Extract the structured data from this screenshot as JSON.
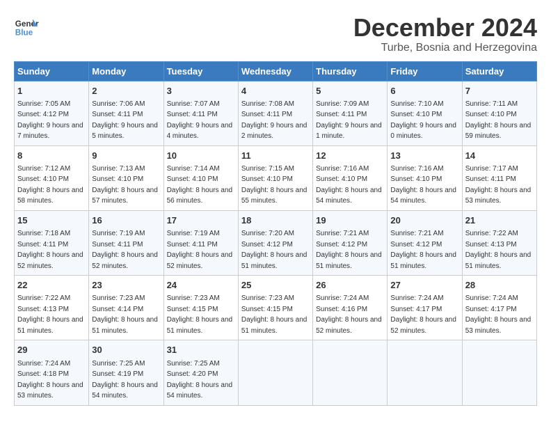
{
  "header": {
    "logo_general": "General",
    "logo_blue": "Blue",
    "title": "December 2024",
    "subtitle": "Turbe, Bosnia and Herzegovina"
  },
  "weekdays": [
    "Sunday",
    "Monday",
    "Tuesday",
    "Wednesday",
    "Thursday",
    "Friday",
    "Saturday"
  ],
  "weeks": [
    [
      {
        "day": "1",
        "sunrise": "7:05 AM",
        "sunset": "4:12 PM",
        "daylight": "9 hours and 7 minutes."
      },
      {
        "day": "2",
        "sunrise": "7:06 AM",
        "sunset": "4:11 PM",
        "daylight": "9 hours and 5 minutes."
      },
      {
        "day": "3",
        "sunrise": "7:07 AM",
        "sunset": "4:11 PM",
        "daylight": "9 hours and 4 minutes."
      },
      {
        "day": "4",
        "sunrise": "7:08 AM",
        "sunset": "4:11 PM",
        "daylight": "9 hours and 2 minutes."
      },
      {
        "day": "5",
        "sunrise": "7:09 AM",
        "sunset": "4:11 PM",
        "daylight": "9 hours and 1 minute."
      },
      {
        "day": "6",
        "sunrise": "7:10 AM",
        "sunset": "4:10 PM",
        "daylight": "9 hours and 0 minutes."
      },
      {
        "day": "7",
        "sunrise": "7:11 AM",
        "sunset": "4:10 PM",
        "daylight": "8 hours and 59 minutes."
      }
    ],
    [
      {
        "day": "8",
        "sunrise": "7:12 AM",
        "sunset": "4:10 PM",
        "daylight": "8 hours and 58 minutes."
      },
      {
        "day": "9",
        "sunrise": "7:13 AM",
        "sunset": "4:10 PM",
        "daylight": "8 hours and 57 minutes."
      },
      {
        "day": "10",
        "sunrise": "7:14 AM",
        "sunset": "4:10 PM",
        "daylight": "8 hours and 56 minutes."
      },
      {
        "day": "11",
        "sunrise": "7:15 AM",
        "sunset": "4:10 PM",
        "daylight": "8 hours and 55 minutes."
      },
      {
        "day": "12",
        "sunrise": "7:16 AM",
        "sunset": "4:10 PM",
        "daylight": "8 hours and 54 minutes."
      },
      {
        "day": "13",
        "sunrise": "7:16 AM",
        "sunset": "4:10 PM",
        "daylight": "8 hours and 54 minutes."
      },
      {
        "day": "14",
        "sunrise": "7:17 AM",
        "sunset": "4:11 PM",
        "daylight": "8 hours and 53 minutes."
      }
    ],
    [
      {
        "day": "15",
        "sunrise": "7:18 AM",
        "sunset": "4:11 PM",
        "daylight": "8 hours and 52 minutes."
      },
      {
        "day": "16",
        "sunrise": "7:19 AM",
        "sunset": "4:11 PM",
        "daylight": "8 hours and 52 minutes."
      },
      {
        "day": "17",
        "sunrise": "7:19 AM",
        "sunset": "4:11 PM",
        "daylight": "8 hours and 52 minutes."
      },
      {
        "day": "18",
        "sunrise": "7:20 AM",
        "sunset": "4:12 PM",
        "daylight": "8 hours and 51 minutes."
      },
      {
        "day": "19",
        "sunrise": "7:21 AM",
        "sunset": "4:12 PM",
        "daylight": "8 hours and 51 minutes."
      },
      {
        "day": "20",
        "sunrise": "7:21 AM",
        "sunset": "4:12 PM",
        "daylight": "8 hours and 51 minutes."
      },
      {
        "day": "21",
        "sunrise": "7:22 AM",
        "sunset": "4:13 PM",
        "daylight": "8 hours and 51 minutes."
      }
    ],
    [
      {
        "day": "22",
        "sunrise": "7:22 AM",
        "sunset": "4:13 PM",
        "daylight": "8 hours and 51 minutes."
      },
      {
        "day": "23",
        "sunrise": "7:23 AM",
        "sunset": "4:14 PM",
        "daylight": "8 hours and 51 minutes."
      },
      {
        "day": "24",
        "sunrise": "7:23 AM",
        "sunset": "4:15 PM",
        "daylight": "8 hours and 51 minutes."
      },
      {
        "day": "25",
        "sunrise": "7:23 AM",
        "sunset": "4:15 PM",
        "daylight": "8 hours and 51 minutes."
      },
      {
        "day": "26",
        "sunrise": "7:24 AM",
        "sunset": "4:16 PM",
        "daylight": "8 hours and 52 minutes."
      },
      {
        "day": "27",
        "sunrise": "7:24 AM",
        "sunset": "4:17 PM",
        "daylight": "8 hours and 52 minutes."
      },
      {
        "day": "28",
        "sunrise": "7:24 AM",
        "sunset": "4:17 PM",
        "daylight": "8 hours and 53 minutes."
      }
    ],
    [
      {
        "day": "29",
        "sunrise": "7:24 AM",
        "sunset": "4:18 PM",
        "daylight": "8 hours and 53 minutes."
      },
      {
        "day": "30",
        "sunrise": "7:25 AM",
        "sunset": "4:19 PM",
        "daylight": "8 hours and 54 minutes."
      },
      {
        "day": "31",
        "sunrise": "7:25 AM",
        "sunset": "4:20 PM",
        "daylight": "8 hours and 54 minutes."
      },
      null,
      null,
      null,
      null
    ]
  ],
  "labels": {
    "sunrise": "Sunrise:",
    "sunset": "Sunset:",
    "daylight": "Daylight:"
  }
}
